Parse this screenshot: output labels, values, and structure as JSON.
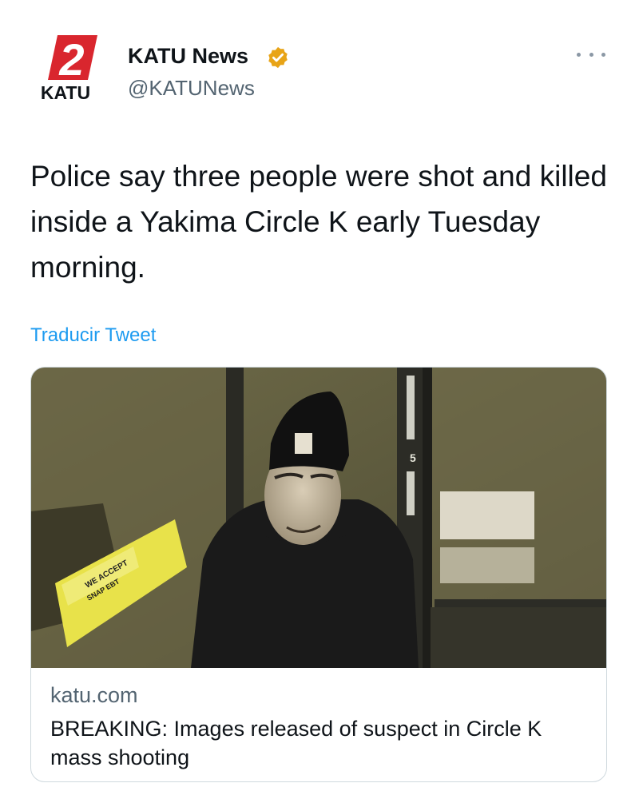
{
  "tweet": {
    "author": {
      "display_name": "KATU News",
      "handle": "@KATUNews",
      "verified": true,
      "logo": {
        "number": "2",
        "wordmark": "KATU"
      },
      "badge_color": "#e8a417"
    },
    "text": "Police say three people were shot and killed inside a Yakima Circle K early Tuesday morning.",
    "translate_label": "Traducir Tweet",
    "more_icon": "more-horizontal-icon"
  },
  "link_card": {
    "domain": "katu.com",
    "title": "BREAKING: Images released of suspect in Circle K mass shooting",
    "image": {
      "signs": [
        "WE ACCEPT",
        "SNAP EBT",
        "5"
      ]
    }
  },
  "colors": {
    "accent": "#1d9bf0",
    "brand_red": "#d9262e",
    "text_primary": "#0f1419",
    "text_secondary": "#536471"
  }
}
